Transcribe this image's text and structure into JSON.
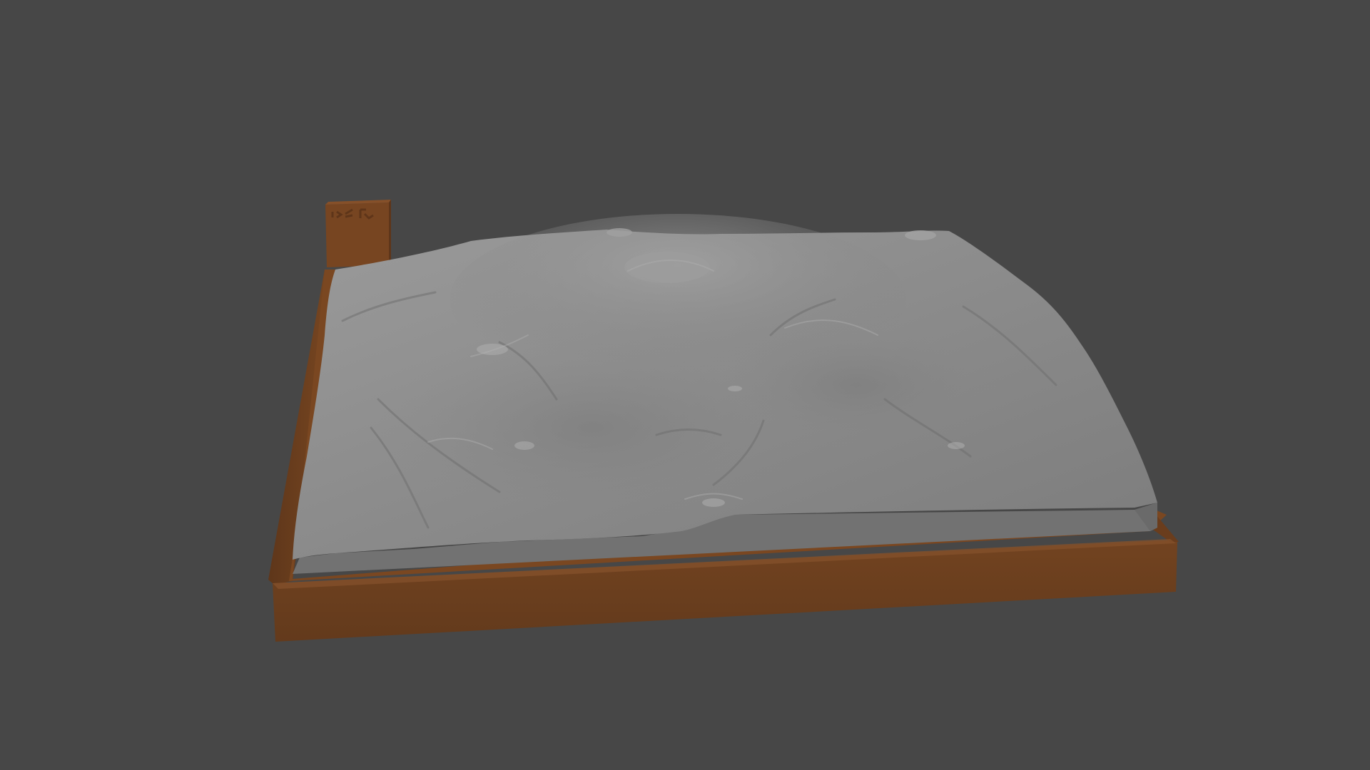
{
  "viewport": {
    "background_color": "#474747",
    "description_free": true
  },
  "model": {
    "base_color": "#6b3f1f",
    "base_top_color": "#76461f",
    "terrain_color": "#8a8a8a",
    "terrain_side_color": "#6f6f6f",
    "tag_block_color": "#74441f",
    "tag_glyphs_text": ""
  }
}
